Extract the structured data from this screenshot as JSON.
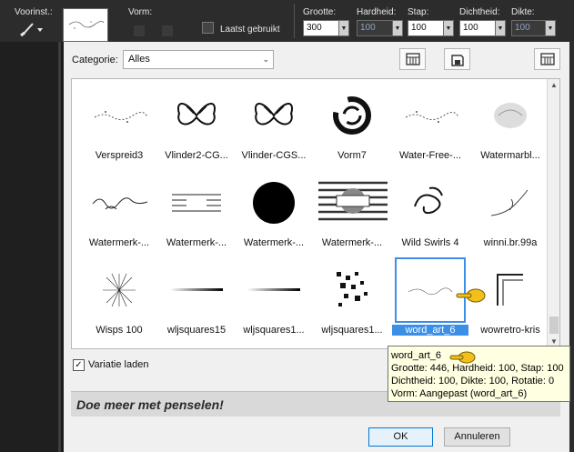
{
  "toolbar": {
    "preset_label": "Voorinst.:",
    "shape_label": "Vorm:",
    "last_used_label": "Laatst gebruikt",
    "size": {
      "label": "Grootte:",
      "value": "300"
    },
    "hardness": {
      "label": "Hardheid:",
      "value": "100"
    },
    "step": {
      "label": "Stap:",
      "value": "100"
    },
    "density": {
      "label": "Dichtheid:",
      "value": "100"
    },
    "thickness": {
      "label": "Dikte:",
      "value": "100"
    }
  },
  "dialog": {
    "category_label": "Categorie:",
    "category_value": "Alles",
    "brushes": [
      {
        "label": "Verspreid3",
        "icon": "scatter-brush"
      },
      {
        "label": "Vlinder2-CG...",
        "icon": "butterfly-brush"
      },
      {
        "label": "Vlinder-CGS...",
        "icon": "butterfly-brush"
      },
      {
        "label": "Vorm7",
        "icon": "swirl-ring-brush"
      },
      {
        "label": "Water-Free-...",
        "icon": "scatter-brush"
      },
      {
        "label": "Watermarbl...",
        "icon": "watermark-brush"
      },
      {
        "label": "Watermerk-...",
        "icon": "script-brush"
      },
      {
        "label": "Watermerk-...",
        "icon": "stripe-text-brush"
      },
      {
        "label": "Watermerk-...",
        "icon": "black-circle-brush"
      },
      {
        "label": "Watermerk-...",
        "icon": "claudia-brush"
      },
      {
        "label": "Wild Swirls 4",
        "icon": "swirls-brush"
      },
      {
        "label": "winni.br.99a",
        "icon": "floral-corner-brush"
      },
      {
        "label": "Wisps 100",
        "icon": "wisps-brush"
      },
      {
        "label": "wljsquares15",
        "icon": "line-gradient-brush"
      },
      {
        "label": "wljsquares1...",
        "icon": "line-gradient-brush"
      },
      {
        "label": "wljsquares1...",
        "icon": "pixel-squares-brush"
      },
      {
        "label": "word_art_6",
        "icon": "word-art-brush"
      },
      {
        "label": "wowretro-kris",
        "icon": "retro-corner-brush"
      }
    ],
    "selected_index": 16,
    "variatie_label": "Variatie laden",
    "variatie_checked": "✓",
    "more_text": "Doe meer met penselen!",
    "ok_label": "OK",
    "cancel_label": "Annuleren"
  },
  "tooltip": {
    "name": "word_art_6",
    "line1": "Grootte: 446, Hardheid: 100, Stap: 100",
    "line2": "Dichtheid: 100, Dikte: 100, Rotatie: 0",
    "line3": "Vorm: Aangepast (word_art_6)"
  },
  "colors": {
    "accent": "#3c8fe6",
    "toolbar_bg": "#2c2c2c",
    "tooltip_bg": "#ffffe1",
    "pointer_hand": "#f2c01c"
  }
}
